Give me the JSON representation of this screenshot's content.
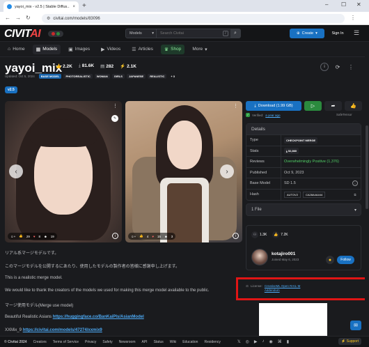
{
  "browser": {
    "tab_title": "yayoi_mix - v2.5 | Stable Diffus...",
    "url": "civitai.com/models/83096",
    "new_tab": "+",
    "tab_close": "×"
  },
  "header": {
    "logo_main": "CIVIT",
    "logo_ai": "AI",
    "search_type": "Models",
    "search_placeholder": "Search Civitai",
    "search_shortcut": "/",
    "create_label": "Create",
    "signin_label": "Sign In"
  },
  "nav": [
    {
      "label": "Home",
      "icon": "⌂"
    },
    {
      "label": "Models",
      "icon": "▦"
    },
    {
      "label": "Images",
      "icon": "▣"
    },
    {
      "label": "Videos",
      "icon": "▶"
    },
    {
      "label": "Articles",
      "icon": "☰"
    },
    {
      "label": "Shop",
      "icon": "♛"
    },
    {
      "label": "More",
      "icon": "▾"
    }
  ],
  "model": {
    "name": "yayoi_mix",
    "stats": {
      "likes": "2.2K",
      "downloads": "81.6K",
      "collections": "282",
      "buzz": "2.1K"
    },
    "updated": "Updated: Oct 5, 2024",
    "tags": [
      "BASE MODEL",
      "PHOTOREALISTIC",
      "WOMAN",
      "GIRLS",
      "JAPANESE",
      "REALISTIC",
      "+ 3"
    ],
    "version": "v2.5"
  },
  "images": [
    {
      "reactions": [
        "29",
        "8",
        "19"
      ]
    },
    {
      "reactions": [
        "4",
        "15",
        "3"
      ]
    }
  ],
  "description": {
    "line1": "リアル系マージモデルです。",
    "line2": "このマージモデルを公開するにあたり、使用したモデルの製作者の皆様に感謝申し上げます。",
    "line3": "This is a realistic merge model.",
    "line4": "We would like to thank the creators of the models we used for making this merge model available to the public.",
    "line5": "マージ使用モデル(Merge use model)",
    "line6_prefix": "Beautiful Realistic Asians",
    "line6_link": "https://huggingface.co/BanKaiPls/AsianModel",
    "line7_prefix": "XXMix_9",
    "line7_link": "https://civitai.com/models/47274/xxmix9"
  },
  "sidebar": {
    "download_label": "Download (1.99 GB)",
    "verified_prefix": "Verified:",
    "verified_link": "a year ago",
    "safetensor": "SafeTensor",
    "details_title": "Details",
    "details": {
      "type_key": "Type",
      "type_val": "CHECKPOINT MERGE",
      "stats_key": "Stats",
      "stats_val": "52,860",
      "reviews_key": "Reviews",
      "reviews_val": "Overwhelmingly Positive (1,376)",
      "published_key": "Published",
      "published_val": "Oct 9, 2023",
      "base_key": "Base Model",
      "base_val": "SD 1.5",
      "hash_key": "Hash",
      "hash_type": "AUTOV2",
      "hash_val": "CA28A4A444"
    },
    "files_label": "1 File",
    "creator": {
      "stat1": "1.3K",
      "stat2": "7.2K",
      "username": "kotajiro001",
      "joined": "Joined May 6, 2023",
      "follow_label": "Follow"
    },
    "license_prefix": "License:",
    "license_link": "CreativeML Open RAIL-M",
    "license_addendum": "Addendum"
  },
  "footer": {
    "copyright": "© Civitai 2024",
    "links": [
      "Creators",
      "Terms of Service",
      "Privacy",
      "Safety",
      "Newsroom",
      "API",
      "Status",
      "Wiki",
      "Education",
      "Residency"
    ],
    "support": "Support"
  }
}
